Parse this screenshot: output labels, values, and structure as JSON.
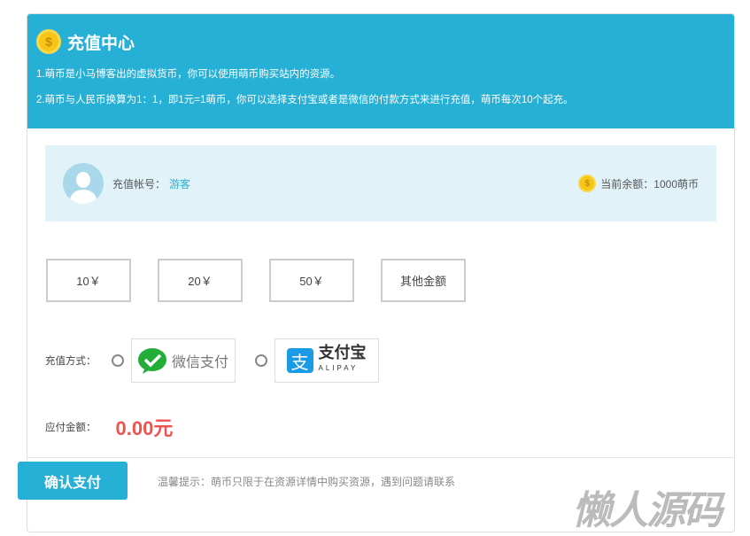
{
  "header": {
    "title": "充值中心",
    "notes": [
      "1.萌币是小马博客出的虚拟货币，你可以使用萌币购买站内的资源。",
      "2.萌币与人民币换算为1：1，即1元=1萌币，你可以选择支付宝或者是微信的付款方式来进行充值，萌币每次10个起充。"
    ]
  },
  "account": {
    "label": "充值帐号：",
    "user": "游客",
    "balance_label": "当前余额：1000萌币"
  },
  "amounts": [
    "10￥",
    "20￥",
    "50￥",
    "其他金额"
  ],
  "payment": {
    "label": "充值方式：",
    "wechat": "微信支付",
    "alipay": "支付宝",
    "alipay_en": "ALIPAY"
  },
  "due": {
    "label": "应付金额：",
    "value": "0.00元"
  },
  "footer": {
    "confirm": "确认支付",
    "tip": "温馨提示：萌币只限于在资源详情中购买资源，遇到问题请联系"
  },
  "watermark": "懒人源码",
  "colors": {
    "accent": "#27b0d6",
    "price": "#ef5350"
  }
}
